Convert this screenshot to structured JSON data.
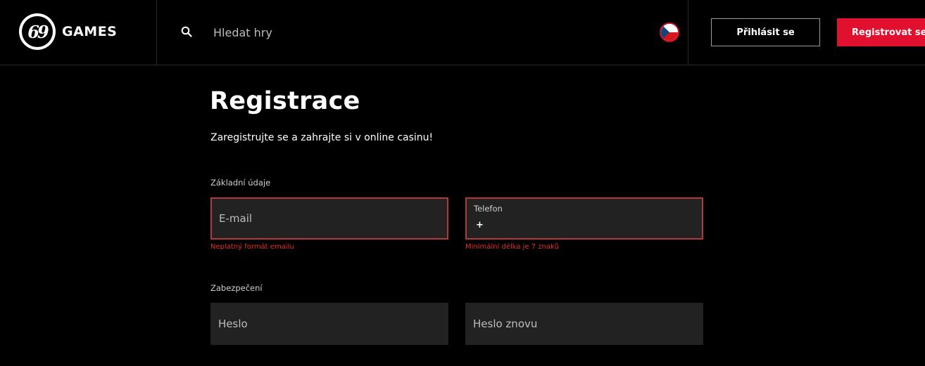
{
  "header": {
    "logo_text": "GAMES",
    "logo_mark": "69",
    "search": {
      "placeholder": "Hledat hry",
      "value": "",
      "icon": "search-icon"
    },
    "language": {
      "icon": "czech-flag-icon"
    },
    "login_label": "Přihlásit se",
    "register_label": "Registrovat se"
  },
  "main": {
    "title": "Registrace",
    "subtitle": "Zaregistrujte se a zahrajte si v online casinu!",
    "sections": {
      "basic": {
        "label": "Základní údaje",
        "email": {
          "placeholder": "E-mail",
          "value": "",
          "error": "Neplatný formát emailu"
        },
        "phone": {
          "label": "Telefon",
          "prefix": "+",
          "value": "",
          "error": "Minimální délka je 7 znaků"
        }
      },
      "security": {
        "label": "Zabezpečení",
        "password": {
          "placeholder": "Heslo",
          "value": ""
        },
        "password_repeat": {
          "placeholder": "Heslo znovu",
          "value": ""
        }
      }
    }
  },
  "colors": {
    "background": "#000000",
    "accent": "#e0102e",
    "field_bg": "#222222",
    "error": "#e03030",
    "error_border": "#b33a3a"
  }
}
